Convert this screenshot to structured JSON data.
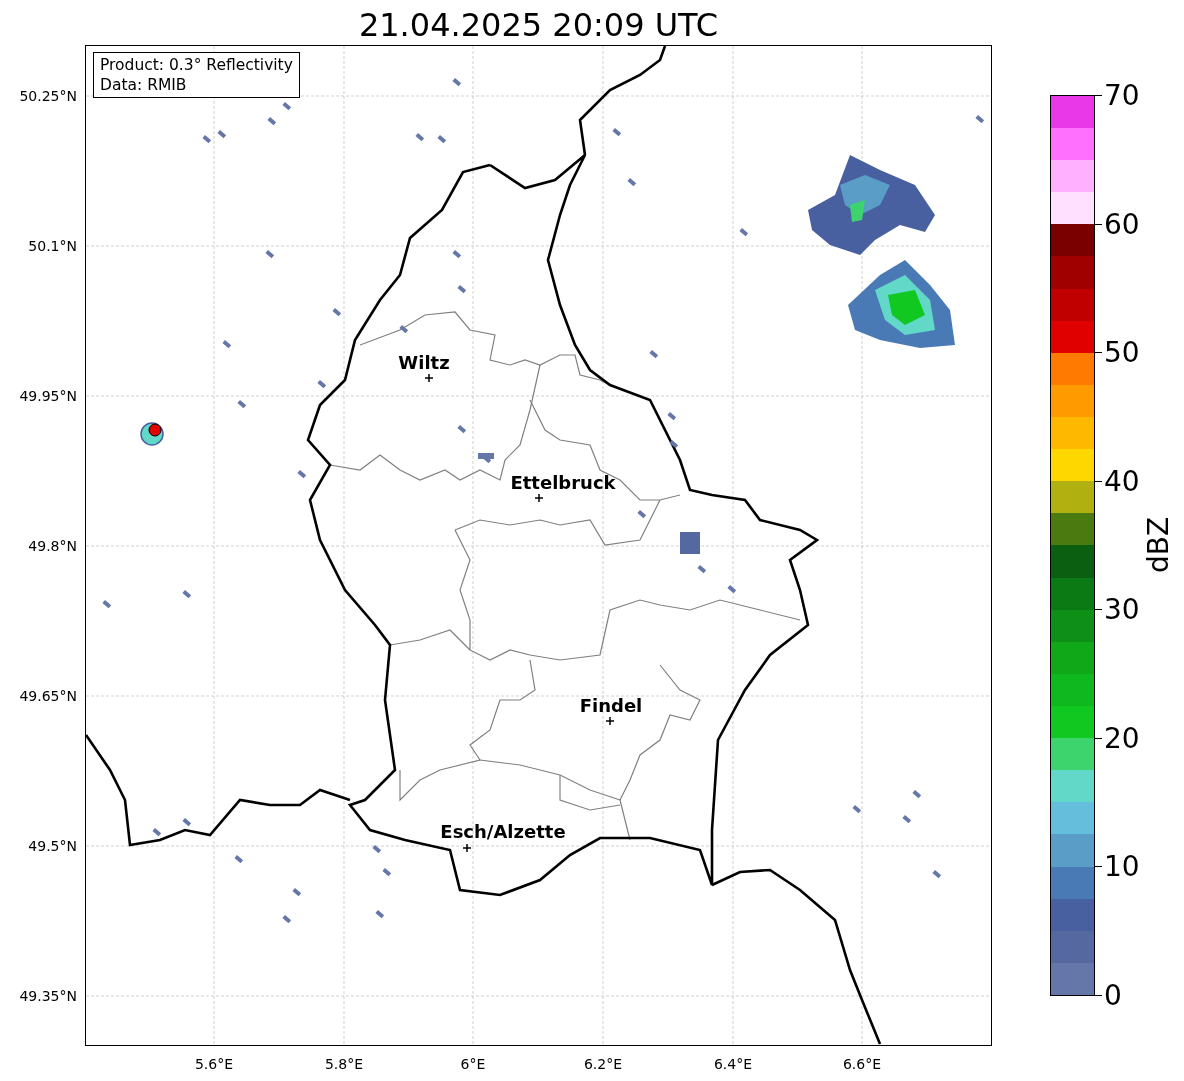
{
  "title": "21.04.2025 20:09 UTC",
  "info_box": [
    "Product: 0.3° Reflectivity",
    "Data: RMIB"
  ],
  "cities": [
    {
      "name": "Wiltz"
    },
    {
      "name": "Ettelbruck"
    },
    {
      "name": "Findel"
    },
    {
      "name": "Esch/Alzette"
    }
  ],
  "y_ticks": [
    "50.25°N",
    "50.1°N",
    "49.95°N",
    "49.8°N",
    "49.65°N",
    "49.5°N",
    "49.35°N"
  ],
  "x_ticks": [
    "5.6°E",
    "5.8°E",
    "6°E",
    "6.2°E",
    "6.4°E",
    "6.6°E"
  ],
  "colorbar": {
    "label": "dBZ",
    "ticks": [
      "70",
      "60",
      "50",
      "40",
      "30",
      "20",
      "10",
      "0"
    ],
    "segments": [
      {
        "color": "#6577a8"
      },
      {
        "color": "#5568a0"
      },
      {
        "color": "#4860a0"
      },
      {
        "color": "#4a7ab5"
      },
      {
        "color": "#5a9ec8"
      },
      {
        "color": "#66bedd"
      },
      {
        "color": "#62d8c8"
      },
      {
        "color": "#3dd46e"
      },
      {
        "color": "#10c820"
      },
      {
        "color": "#10b820"
      },
      {
        "color": "#10a818"
      },
      {
        "color": "#0e9018"
      },
      {
        "color": "#0c7a14"
      },
      {
        "color": "#0a6010"
      },
      {
        "color": "#4a7a10"
      },
      {
        "color": "#b0b010"
      },
      {
        "color": "#ffd700"
      },
      {
        "color": "#ffb800"
      },
      {
        "color": "#ff9a00"
      },
      {
        "color": "#ff7a00"
      },
      {
        "color": "#e00000"
      },
      {
        "color": "#c00000"
      },
      {
        "color": "#a00000"
      },
      {
        "color": "#7a0000"
      },
      {
        "color": "#ffe0ff"
      },
      {
        "color": "#ffb0ff"
      },
      {
        "color": "#ff70ff"
      },
      {
        "color": "#e838e8"
      }
    ]
  }
}
